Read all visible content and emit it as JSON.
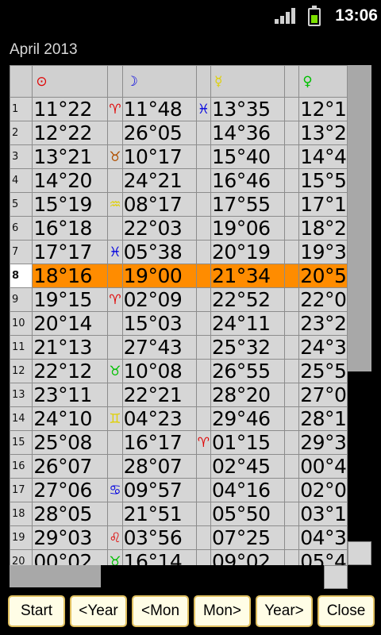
{
  "status": {
    "time": "13:06"
  },
  "title": "April 2013",
  "headers": [
    {
      "symbol": "⊙",
      "color": "#e00000"
    },
    {
      "symbol": "☽",
      "color": "#0000e0"
    },
    {
      "symbol": "☿",
      "color": "#e0d000"
    },
    {
      "symbol": "♀",
      "color": "#00c000"
    }
  ],
  "rows": [
    {
      "day": "1",
      "s1": "♈",
      "s1c": "#e00000",
      "v1": "11°22",
      "s2": "♐",
      "s2c": "#e00000",
      "v2": "11°48",
      "s3": "♓",
      "s3c": "#0000e0",
      "v3": "13°35",
      "v4": "12°1"
    },
    {
      "day": "2",
      "v1": "12°22",
      "v2": "26°05",
      "v3": "14°36",
      "v4": "13°2"
    },
    {
      "day": "3",
      "v1": "13°21",
      "s2": "♉",
      "s2c": "#b05000",
      "v2": "10°17",
      "v3": "15°40",
      "v4": "14°4"
    },
    {
      "day": "4",
      "v1": "14°20",
      "v2": "24°21",
      "v3": "16°46",
      "v4": "15°5"
    },
    {
      "day": "5",
      "v1": "15°19",
      "s2": "♒",
      "s2c": "#e0d000",
      "v2": "08°17",
      "v3": "17°55",
      "v4": "17°1"
    },
    {
      "day": "6",
      "v1": "16°18",
      "v2": "22°03",
      "v3": "19°06",
      "v4": "18°2"
    },
    {
      "day": "7",
      "v1": "17°17",
      "s2": "♓",
      "s2c": "#0000e0",
      "v2": "05°38",
      "v3": "20°19",
      "v4": "19°3"
    },
    {
      "day": "8",
      "v1": "18°16",
      "v2": "19°00",
      "v3": "21°34",
      "v4": "20°5",
      "highlight": true
    },
    {
      "day": "9",
      "v1": "19°15",
      "s2": "♈",
      "s2c": "#e00000",
      "v2": "02°09",
      "v3": "22°52",
      "v4": "22°0"
    },
    {
      "day": "10",
      "v1": "20°14",
      "v2": "15°03",
      "v3": "24°11",
      "v4": "23°2"
    },
    {
      "day": "11",
      "v1": "21°13",
      "v2": "27°43",
      "v3": "25°32",
      "v4": "24°3"
    },
    {
      "day": "12",
      "v1": "22°12",
      "s2": "♉",
      "s2c": "#00c000",
      "v2": "10°08",
      "v3": "26°55",
      "v4": "25°5"
    },
    {
      "day": "13",
      "v1": "23°11",
      "v2": "22°21",
      "v3": "28°20",
      "v4": "27°0"
    },
    {
      "day": "14",
      "v1": "24°10",
      "s2": "♊",
      "s2c": "#e0d000",
      "v2": "04°23",
      "v3": "29°46",
      "v4": "28°1"
    },
    {
      "day": "15",
      "v1": "25°08",
      "v2": "16°17",
      "s3": "♈",
      "s3c": "#e00000",
      "v3": "01°15",
      "v4": "29°3"
    },
    {
      "day": "16",
      "v1": "26°07",
      "v2": "28°07",
      "v3": "02°45",
      "v4": "00°4"
    },
    {
      "day": "17",
      "v1": "27°06",
      "s2": "♋",
      "s2c": "#0000e0",
      "v2": "09°57",
      "v3": "04°16",
      "v4": "02°0"
    },
    {
      "day": "18",
      "v1": "28°05",
      "v2": "21°51",
      "v3": "05°50",
      "v4": "03°1"
    },
    {
      "day": "19",
      "v1": "29°03",
      "s2": "♌",
      "s2c": "#e00000",
      "v2": "03°56",
      "v3": "07°25",
      "v4": "04°3"
    },
    {
      "day": "20",
      "s1": "♉",
      "s1c": "#00c000",
      "v1": "00°02",
      "v2": "16°14",
      "v3": "09°02",
      "v4": "05°4"
    }
  ],
  "buttons": {
    "start": "Start",
    "prev_year": "<Year",
    "prev_month": "<Mon",
    "next_month": "Mon>",
    "next_year": "Year>",
    "close": "Close"
  }
}
